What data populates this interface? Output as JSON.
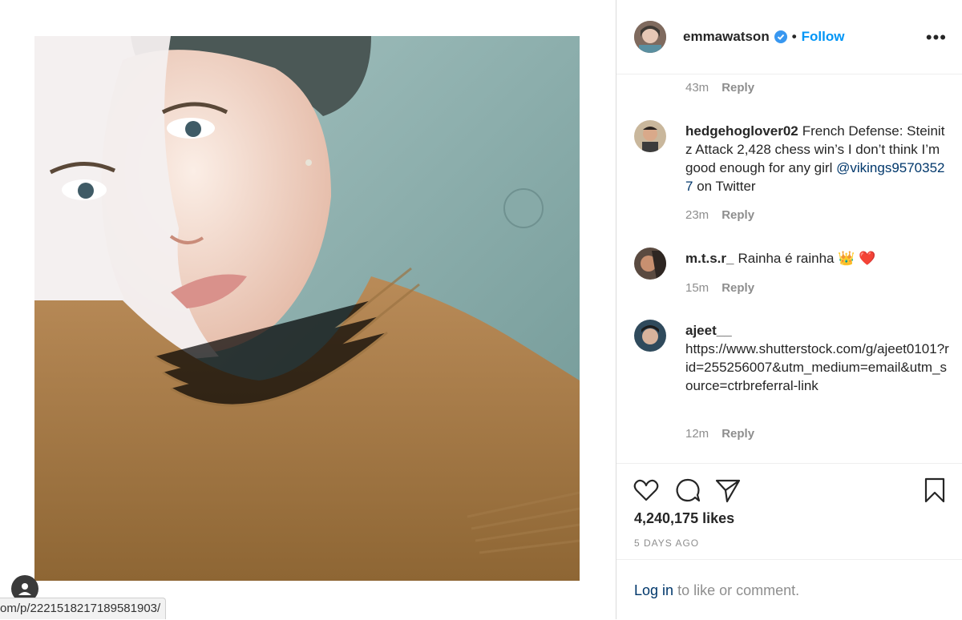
{
  "status_bar": {
    "url": "om/p/2221518217189581903/"
  },
  "post": {
    "username": "emmawatson",
    "separator": "•",
    "follow_label": "Follow",
    "more_label": "•••"
  },
  "comments": [
    {
      "username": "",
      "text": "",
      "time": "43m",
      "reply": "Reply"
    },
    {
      "username": "hedgehoglover02",
      "text": "French Defense: Steinitz Attack 2,428 chess win’s I don’t think I’m good enough for any girl",
      "mention": "@vikings95703527",
      "text_after": "on Twitter",
      "time": "23m",
      "reply": "Reply"
    },
    {
      "username": "m.t.s.r_",
      "text": "Rainha é rainha",
      "emoji": "👑 ❤️",
      "time": "15m",
      "reply": "Reply"
    },
    {
      "username": "ajeet__",
      "text": "https://www.shutterstock.com/g/ajeet0101?rid=255256007&utm_medium=email&utm_source=ctrbreferral-link",
      "time": "12m",
      "reply": "Reply"
    }
  ],
  "actions": {
    "likes": "4,240,175 likes",
    "time_ago": "5 DAYS AGO"
  },
  "login": {
    "link": "Log in",
    "rest": "to like or comment."
  },
  "icons": [
    "verified-badge-icon",
    "more-options-icon",
    "heart-icon",
    "comment-icon",
    "share-icon",
    "bookmark-icon",
    "user-avatar-icon"
  ],
  "colors": {
    "accent": "#0095f6",
    "link": "#00376b",
    "muted": "#8e8e8e",
    "text": "#262626"
  }
}
